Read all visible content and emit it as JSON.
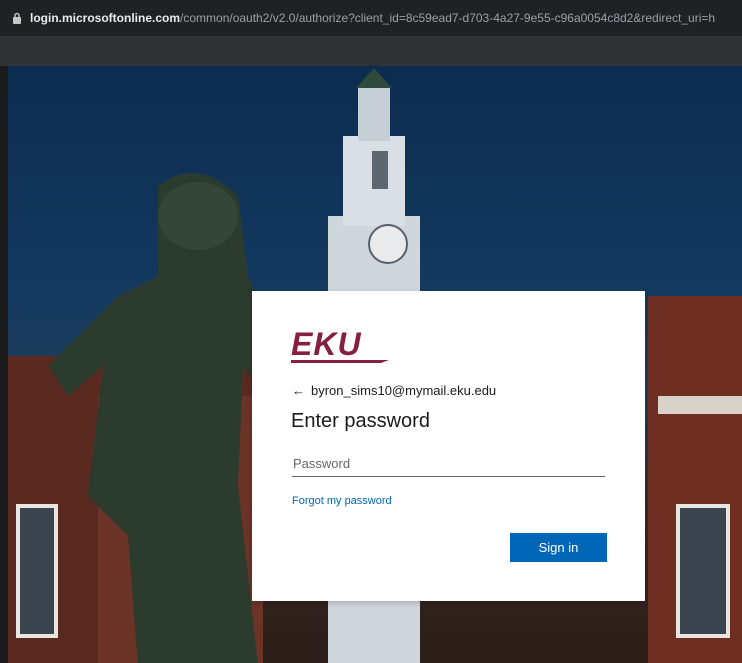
{
  "browser": {
    "url_host": "login.microsoftonline.com",
    "url_path": "/common/oauth2/v2.0/authorize?client_id=8c59ead7-d703-4a27-9e55-c96a0054c8d2&redirect_uri=h",
    "lock_icon": "lock-icon"
  },
  "signin": {
    "logo_text": "EKU",
    "brand_color": "#861f41",
    "back_icon": "arrow-left-icon",
    "back_arrow": "←",
    "email": "byron_sims10@mymail.eku.edu",
    "title": "Enter password",
    "password_placeholder": "Password",
    "forgot_link": "Forgot my password",
    "submit_label": "Sign in",
    "accent_color": "#0067b8"
  }
}
